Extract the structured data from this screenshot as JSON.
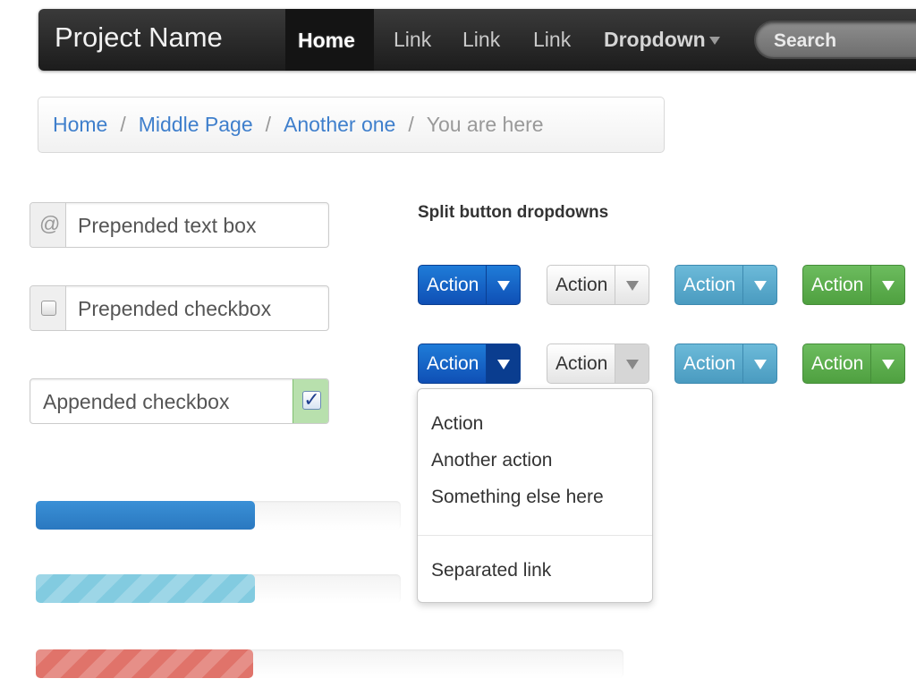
{
  "navbar": {
    "brand": "Project Name",
    "active": "Home",
    "links": [
      "Link",
      "Link",
      "Link"
    ],
    "dropdown": "Dropdown",
    "search_placeholder": "Search"
  },
  "breadcrumb": {
    "items": [
      "Home",
      "Middle Page",
      "Another one"
    ],
    "separator": "/",
    "current": "You are here"
  },
  "inputs": {
    "prepended_addon": "@",
    "prepended_text": "Prepended text box",
    "prepended_checkbox": "Prepended checkbox",
    "appended_checkbox": "Appended checkbox",
    "appended_check_mark": "✓"
  },
  "split_section": {
    "title": "Split button dropdowns",
    "button_label": "Action"
  },
  "dropdown_menu": {
    "items": [
      "Action",
      "Another action",
      "Something else here"
    ],
    "separated": "Separated link"
  },
  "progress": [
    {
      "value": 0.6,
      "style": "blue"
    },
    {
      "value": 0.6,
      "style": "info-striped"
    },
    {
      "value": 0.37,
      "style": "danger-striped"
    }
  ],
  "colors": {
    "primary": "#0f4fb5",
    "info": "#4a9bc0",
    "success": "#4fa040",
    "danger": "#e0736a",
    "link": "#3f7fcc"
  }
}
